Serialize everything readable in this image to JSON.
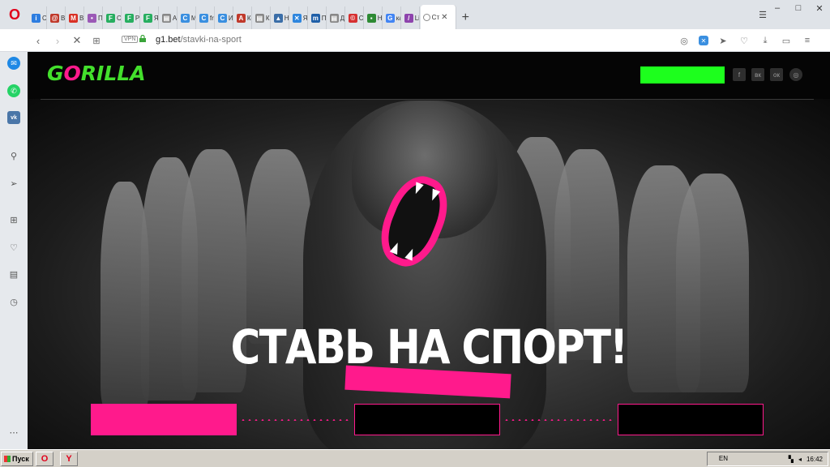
{
  "browser": {
    "logo": "O",
    "tabs": [
      {
        "label": "Сп",
        "icon": "i-icon",
        "color": "#2d7de0",
        "glyph": "i"
      },
      {
        "label": "Вх",
        "icon": "mail100-icon",
        "color": "#c0392b",
        "glyph": "@"
      },
      {
        "label": "Вх",
        "icon": "gmail-icon",
        "color": "#d93025",
        "glyph": "M"
      },
      {
        "label": "Па",
        "icon": "photo-icon",
        "color": "#9b59b6",
        "glyph": "•"
      },
      {
        "label": "Ст",
        "icon": "form-icon",
        "color": "#27ae60",
        "glyph": "F"
      },
      {
        "label": "Ре",
        "icon": "form-icon",
        "color": "#27ae60",
        "glyph": "F"
      },
      {
        "label": "Як",
        "icon": "form-icon",
        "color": "#27ae60",
        "glyph": "F"
      },
      {
        "label": "Ав",
        "icon": "doc-icon",
        "color": "#888888",
        "glyph": "▤"
      },
      {
        "label": "Мс",
        "icon": "c-icon",
        "color": "#3a8fe0",
        "glyph": "C"
      },
      {
        "label": "fre",
        "icon": "c-icon",
        "color": "#3a8fe0",
        "glyph": "C"
      },
      {
        "label": "Ис",
        "icon": "c-icon",
        "color": "#3a8fe0",
        "glyph": "C"
      },
      {
        "label": "Ко",
        "icon": "a-icon",
        "color": "#c0392b",
        "glyph": "A"
      },
      {
        "label": "Кр",
        "icon": "doc-icon",
        "color": "#888888",
        "glyph": "▤"
      },
      {
        "label": "Но",
        "icon": "image-icon",
        "color": "#3b6ea8",
        "glyph": "▲"
      },
      {
        "label": "Як",
        "icon": "x-icon",
        "color": "#2e86de",
        "glyph": "✕"
      },
      {
        "label": "Пл",
        "icon": "m-icon",
        "color": "#1f5fa8",
        "glyph": "m"
      },
      {
        "label": "До",
        "icon": "doc-icon",
        "color": "#888888",
        "glyph": "▤"
      },
      {
        "label": "Ст",
        "icon": "copyright-icon",
        "color": "#d63031",
        "glyph": "©"
      },
      {
        "label": "Но",
        "icon": "chart-icon",
        "color": "#2d8a34",
        "glyph": "▪"
      },
      {
        "label": "ка",
        "icon": "google-icon",
        "color": "#4285f4",
        "glyph": "G"
      },
      {
        "label": "Lig",
        "icon": "feather-icon",
        "color": "#8e44ad",
        "glyph": "/"
      }
    ],
    "active_tab": {
      "label": "Ст",
      "icon": "loading-icon"
    },
    "new_tab": "+",
    "tab_menu": "☰",
    "window_controls": [
      "–",
      "□",
      "✕"
    ],
    "url_host": "g1.bet",
    "url_path": "/stavki-na-sport",
    "vpn": "VPN"
  },
  "sidebar": {
    "items": [
      "messenger-icon",
      "whatsapp-icon",
      "vk-icon",
      "search-icon",
      "send-icon",
      "speed-dial-icon",
      "heart-icon",
      "news-icon",
      "history-icon",
      "more-icon"
    ]
  },
  "site": {
    "logo_prefix": "G",
    "logo_o": "O",
    "logo_suffix": "RILLA",
    "headline": "СТАВЬ НА СПОРТ!",
    "social": [
      "f",
      "вк",
      "ок",
      "◎"
    ],
    "accent_green": "#1dff1d",
    "accent_pink": "#ff1a8c"
  },
  "taskbar": {
    "start": "Пуск",
    "apps": [
      "O",
      "Y"
    ],
    "lang": "EN",
    "clock": "16:42"
  }
}
